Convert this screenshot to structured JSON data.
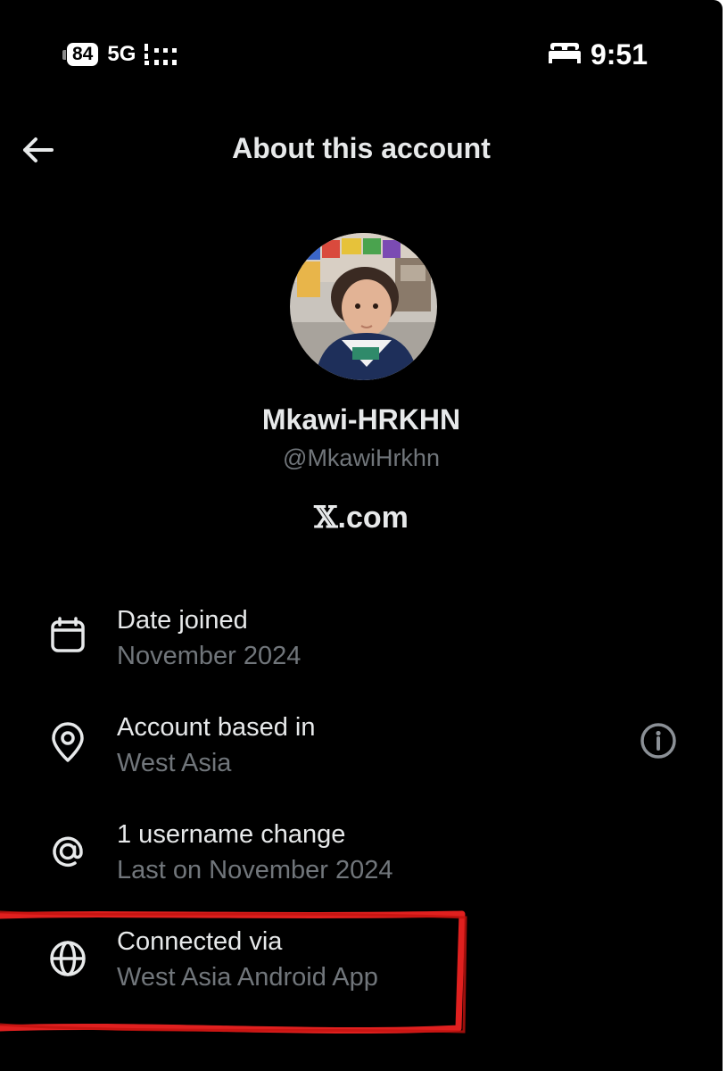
{
  "status_bar": {
    "battery": "84",
    "network": "5G",
    "time": "9:51",
    "icons": [
      "battery-icon",
      "signal-icon",
      "sleep-mode-bed-icon"
    ]
  },
  "header": {
    "title": "About this account",
    "back_icon": "arrow-left-icon"
  },
  "profile": {
    "display_name": "Mkawi-HRKHN",
    "handle": "@MkawiHrkhn",
    "site_x": "𝕏",
    "site_rest": ".com"
  },
  "rows": [
    {
      "icon": "calendar-icon",
      "title": "Date joined",
      "subtitle": "November 2024"
    },
    {
      "icon": "location-pin-icon",
      "title": "Account based in",
      "subtitle": "West Asia",
      "action_icon": "info-icon"
    },
    {
      "icon": "at-sign-icon",
      "title": "1 username change",
      "subtitle": "Last on November 2024"
    },
    {
      "icon": "globe-icon",
      "title": "Connected via",
      "subtitle": "West Asia Android App"
    }
  ],
  "colors": {
    "background": "#000000",
    "primary_text": "#e7e9ea",
    "secondary_text": "#71767b",
    "annotation": "#e0201f"
  }
}
